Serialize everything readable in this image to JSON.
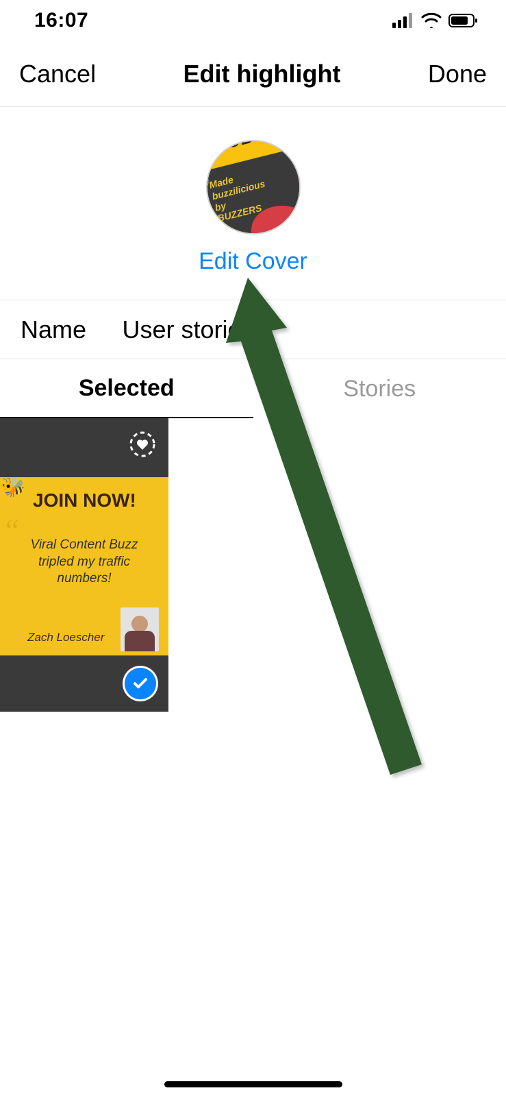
{
  "statusbar": {
    "time": "16:07"
  },
  "header": {
    "cancel": "Cancel",
    "title": "Edit highlight",
    "done": "Done"
  },
  "cover": {
    "brand_top": "CBUZZ",
    "line1": "Made",
    "line2": "buzzilicious",
    "line3": "by",
    "line4": "BUZZERS",
    "edit_link": "Edit Cover"
  },
  "name": {
    "label": "Name",
    "value": "User stories!"
  },
  "tabs": {
    "selected": "Selected",
    "stories": "Stories"
  },
  "tile": {
    "join": "JOIN NOW!",
    "quote": "Viral Content Buzz tripled my traffic numbers!",
    "author": "Zach Loescher"
  },
  "colors": {
    "link_blue": "#0a84ff",
    "arrow_green": "#2d5a2d"
  }
}
